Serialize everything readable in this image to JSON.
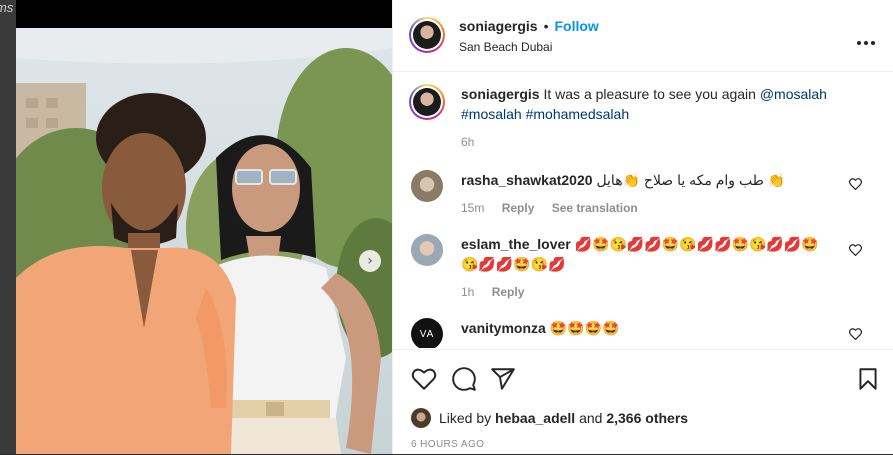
{
  "edge_text": "ms",
  "post": {
    "username": "soniagergis",
    "separator": "•",
    "follow_label": "Follow",
    "location": "San Beach Dubai",
    "more_icon": "more-horizontal-icon"
  },
  "caption": {
    "username": "soniagergis",
    "text": "It was a pleasure to see you again",
    "mention": "@mosalah",
    "hashtags": "#mosalah #mohamedsalah",
    "time": "6h"
  },
  "comments": [
    {
      "username": "rasha_shawkat2020",
      "text": "طب وام مكه يا صلاح 👏هايل 👏",
      "time": "15m",
      "reply_label": "Reply",
      "translation_label": "See translation"
    },
    {
      "username": "eslam_the_lover",
      "text": "💋🤩😘💋💋🤩😘💋💋🤩😘💋💋🤩",
      "text2": "😘💋💋🤩😘💋",
      "time": "1h",
      "reply_label": "Reply"
    },
    {
      "username": "vanitymonza",
      "text": "🤩🤩🤩🤩",
      "avatar_text": "VA"
    }
  ],
  "actions": {
    "like_icon": "heart-icon",
    "comment_icon": "comment-icon",
    "share_icon": "share-icon",
    "save_icon": "bookmark-icon"
  },
  "likes": {
    "prefix": "Liked by",
    "user": "hebaa_adell",
    "and": "and",
    "others": "2,366 others"
  },
  "timestamp": "6 HOURS AGO",
  "colors": {
    "accent": "#0095f6",
    "mention": "#00376b",
    "secondary_text": "#8e8e8e"
  }
}
